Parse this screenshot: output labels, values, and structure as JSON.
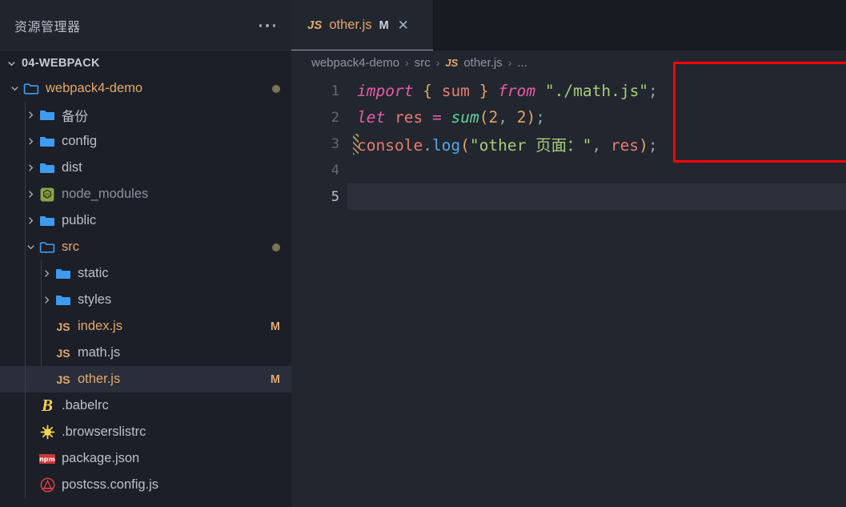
{
  "sidebar": {
    "title": "资源管理器",
    "more_icon": "ellipsis-icon",
    "root": {
      "label": "04-WEBPACK",
      "expanded": true
    },
    "items": [
      {
        "label": "webpack4-demo",
        "type": "folder",
        "depth": 1,
        "expanded": true,
        "modified": true,
        "dot": true
      },
      {
        "label": "备份",
        "type": "folder",
        "depth": 2,
        "expanded": false
      },
      {
        "label": "config",
        "type": "folder",
        "depth": 2,
        "expanded": false
      },
      {
        "label": "dist",
        "type": "folder",
        "depth": 2,
        "expanded": false
      },
      {
        "label": "node_modules",
        "type": "node",
        "depth": 2,
        "expanded": false,
        "dim": true
      },
      {
        "label": "public",
        "type": "folder",
        "depth": 2,
        "expanded": false
      },
      {
        "label": "src",
        "type": "folder",
        "depth": 2,
        "expanded": true,
        "modified": true,
        "dot": true
      },
      {
        "label": "static",
        "type": "folder",
        "depth": 3,
        "expanded": false
      },
      {
        "label": "styles",
        "type": "folder",
        "depth": 3,
        "expanded": false
      },
      {
        "label": "index.js",
        "type": "js",
        "depth": 3,
        "modified": true,
        "badge": "M"
      },
      {
        "label": "math.js",
        "type": "js",
        "depth": 3
      },
      {
        "label": "other.js",
        "type": "js",
        "depth": 3,
        "modified": true,
        "badge": "M",
        "selected": true
      },
      {
        "label": ".babelrc",
        "type": "babel",
        "depth": 2
      },
      {
        "label": ".browserslistrc",
        "type": "browserslist",
        "depth": 2
      },
      {
        "label": "package.json",
        "type": "npm",
        "depth": 2
      },
      {
        "label": "postcss.config.js",
        "type": "postcss",
        "depth": 2
      }
    ]
  },
  "tab": {
    "icon": "js-icon",
    "name": "other.js",
    "modified_badge": "M",
    "close_icon": "✕"
  },
  "breadcrumb": {
    "parts": [
      "webpack4-demo",
      "src",
      "other.js",
      "..."
    ],
    "separator": "›",
    "file_icon": "JS"
  },
  "editor": {
    "line_numbers": [
      "1",
      "2",
      "3",
      "4",
      "5"
    ],
    "active_line": 5,
    "lines": [
      {
        "n": "1",
        "tokens": [
          {
            "t": "import",
            "c": "kw"
          },
          {
            "t": " ",
            "c": "pun"
          },
          {
            "t": "{",
            "c": "brc"
          },
          {
            "t": " ",
            "c": "pun"
          },
          {
            "t": "sum",
            "c": "var"
          },
          {
            "t": " ",
            "c": "pun"
          },
          {
            "t": "}",
            "c": "brc"
          },
          {
            "t": " ",
            "c": "pun"
          },
          {
            "t": "from",
            "c": "kw"
          },
          {
            "t": " ",
            "c": "pun"
          },
          {
            "t": "\"./math.js\"",
            "c": "str"
          },
          {
            "t": ";",
            "c": "pun"
          }
        ]
      },
      {
        "n": "2",
        "tokens": [
          {
            "t": "let",
            "c": "kw"
          },
          {
            "t": " ",
            "c": "pun"
          },
          {
            "t": "res",
            "c": "var"
          },
          {
            "t": " ",
            "c": "pun"
          },
          {
            "t": "=",
            "c": "op"
          },
          {
            "t": " ",
            "c": "pun"
          },
          {
            "t": "sum",
            "c": "fn"
          },
          {
            "t": "(",
            "c": "brc"
          },
          {
            "t": "2",
            "c": "num"
          },
          {
            "t": ", ",
            "c": "pun"
          },
          {
            "t": "2",
            "c": "num"
          },
          {
            "t": ")",
            "c": "brc"
          },
          {
            "t": ";",
            "c": "pun"
          }
        ]
      },
      {
        "n": "3",
        "tokens": [
          {
            "t": "console",
            "c": "var"
          },
          {
            "t": ".",
            "c": "pun"
          },
          {
            "t": "log",
            "c": "prop"
          },
          {
            "t": "(",
            "c": "brc"
          },
          {
            "t": "\"other 页面：\"",
            "c": "str"
          },
          {
            "t": ", ",
            "c": "pun"
          },
          {
            "t": "res",
            "c": "var"
          },
          {
            "t": ")",
            "c": "brc"
          },
          {
            "t": ";",
            "c": "pun"
          }
        ]
      },
      {
        "n": "4",
        "tokens": []
      },
      {
        "n": "5",
        "tokens": []
      }
    ],
    "line3_change_marker": true
  },
  "annotation": {
    "shape": "rectangle",
    "color": "#fe0000"
  },
  "colors": {
    "sidebar_bg": "#1c1f27",
    "editor_bg": "#22262f",
    "tabbar_bg": "#181b21",
    "accent_orange": "#e2a96c",
    "folder_blue": "#3e9bf0",
    "annotation_red": "#fe0000"
  }
}
